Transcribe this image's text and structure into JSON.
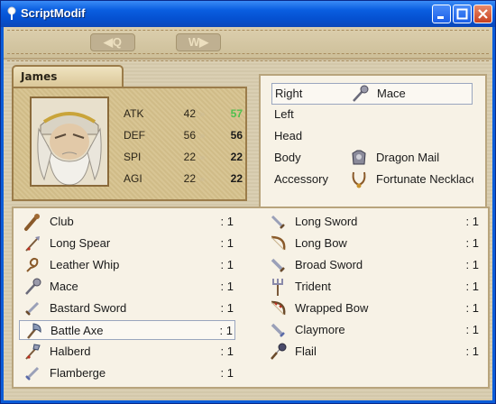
{
  "window": {
    "title": "ScriptModif"
  },
  "nav": {
    "prev_label": "◀Q",
    "next_label": "W▶"
  },
  "actor": {
    "name": "James",
    "stats": [
      {
        "label": "ATK",
        "current": "42",
        "new": "57",
        "change": "up"
      },
      {
        "label": "DEF",
        "current": "56",
        "new": "56",
        "change": "same"
      },
      {
        "label": "SPI",
        "current": "22",
        "new": "22",
        "change": "same"
      },
      {
        "label": "AGI",
        "current": "22",
        "new": "22",
        "change": "same"
      }
    ],
    "arrow_glyph": "»"
  },
  "equip_slots": [
    {
      "slot": "Right",
      "item": "Mace",
      "icon": "mace-icon",
      "selected": true
    },
    {
      "slot": "Left",
      "item": "",
      "icon": "",
      "selected": false
    },
    {
      "slot": "Head",
      "item": "",
      "icon": "",
      "selected": false
    },
    {
      "slot": "Body",
      "item": "Dragon Mail",
      "icon": "armor-icon",
      "selected": false
    },
    {
      "slot": "Accessory",
      "item": "Fortunate Necklace",
      "icon": "necklace-icon",
      "selected": false
    }
  ],
  "items": [
    {
      "name": "Club",
      "qty": ": 1",
      "icon": "club-icon"
    },
    {
      "name": "Long Sword",
      "qty": ": 1",
      "icon": "sword-icon"
    },
    {
      "name": "Long Spear",
      "qty": ": 1",
      "icon": "spear-icon"
    },
    {
      "name": "Long Bow",
      "qty": ": 1",
      "icon": "bow-icon"
    },
    {
      "name": "Leather Whip",
      "qty": ": 1",
      "icon": "whip-icon"
    },
    {
      "name": "Broad Sword",
      "qty": ": 1",
      "icon": "sword-icon"
    },
    {
      "name": "Mace",
      "qty": ": 1",
      "icon": "mace-icon"
    },
    {
      "name": "Trident",
      "qty": ": 1",
      "icon": "trident-icon"
    },
    {
      "name": "Bastard Sword",
      "qty": ": 1",
      "icon": "sword-icon"
    },
    {
      "name": "Wrapped Bow",
      "qty": ": 1",
      "icon": "bow-icon"
    },
    {
      "name": "Battle Axe",
      "qty": ": 1",
      "icon": "axe-icon",
      "selected": true
    },
    {
      "name": "Claymore",
      "qty": ": 1",
      "icon": "sword-icon"
    },
    {
      "name": "Halberd",
      "qty": ": 1",
      "icon": "halberd-icon"
    },
    {
      "name": "Flail",
      "qty": ": 1",
      "icon": "flail-icon"
    },
    {
      "name": "Flamberge",
      "qty": ": 1",
      "icon": "sword-icon"
    }
  ],
  "colors": {
    "stat_up": "#4fc04f",
    "titlebar": "#0a5ee0",
    "selection_border": "#9aa6bf"
  }
}
